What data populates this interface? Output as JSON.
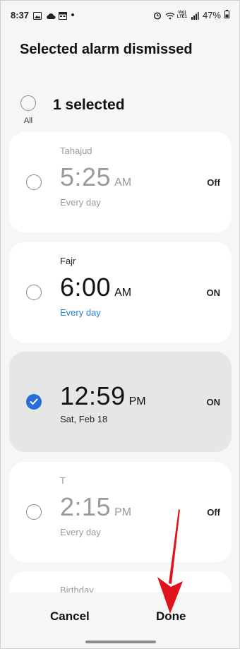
{
  "status_bar": {
    "time": "8:37",
    "volte_line1": "Vo))",
    "volte_line2": "LTE1",
    "battery": "47%"
  },
  "header": {
    "title": "Selected alarm dismissed",
    "select_all_label": "All",
    "selected_count": "1 selected"
  },
  "alarms": [
    {
      "name": "Tahajud",
      "time": "5:25",
      "ampm": "AM",
      "repeat": "Every day",
      "state": "Off",
      "selected": false
    },
    {
      "name": "Fajr",
      "time": "6:00",
      "ampm": "AM",
      "repeat": "Every day",
      "state": "ON",
      "selected": false
    },
    {
      "name": "",
      "time": "12:59",
      "ampm": "PM",
      "repeat": "Sat, Feb 18",
      "state": "ON",
      "selected": true
    },
    {
      "name": "T",
      "time": "2:15",
      "ampm": "PM",
      "repeat": "Every day",
      "state": "Off",
      "selected": false
    },
    {
      "name": "Birthday"
    }
  ],
  "bottom_bar": {
    "cancel_label": "Cancel",
    "done_label": "Done"
  },
  "colors": {
    "accent": "#2a6fd8",
    "repeat_blue": "#2a7fd4",
    "annotation_arrow": "#e0131a"
  },
  "icons": [
    "gallery-icon",
    "cloud-icon",
    "calendar-icon",
    "alarm-icon",
    "wifi-icon",
    "signal-icon",
    "battery-icon",
    "check-icon",
    "arrow-annotation"
  ]
}
